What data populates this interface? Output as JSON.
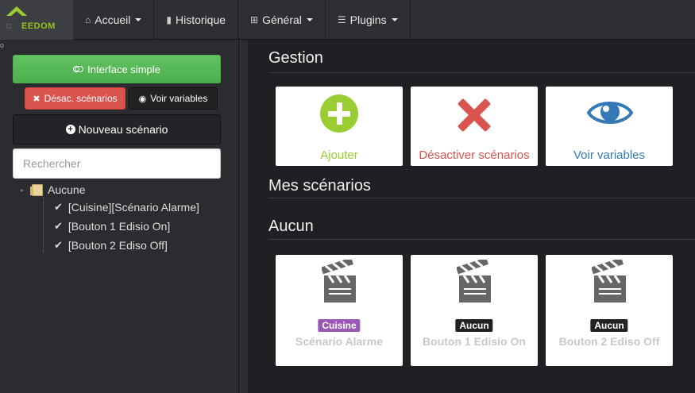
{
  "nav": {
    "brand": "EEDOM",
    "items": [
      {
        "icon": "home-icon",
        "label": "Accueil",
        "dropdown": true
      },
      {
        "icon": "bar-chart-icon",
        "label": "Historique",
        "dropdown": false
      },
      {
        "icon": "grid-icon",
        "label": "Général",
        "dropdown": true
      },
      {
        "icon": "list-icon",
        "label": "Plugins",
        "dropdown": true
      }
    ]
  },
  "sidebar": {
    "corner_mark": "o",
    "interface_button": "Interface simple",
    "disable_button": "Désac. scénarios",
    "variables_button": "Voir variables",
    "new_button": "Nouveau scénario",
    "search_placeholder": "Rechercher",
    "tree": {
      "root_label": "Aucune",
      "leaves": [
        "[Cuisine][Scénario Alarme]",
        "[Bouton 1 Edisio On]",
        "[Bouton 2 Ediso Off]"
      ]
    }
  },
  "main": {
    "gestion_title": "Gestion",
    "gestion_cards": [
      {
        "label": "Ajouter",
        "color": "#9acd32",
        "icon": "plus-circle-icon"
      },
      {
        "label": "Désactiver scénarios",
        "color": "#d9534f",
        "icon": "x-icon"
      },
      {
        "label": "Voir variables",
        "color": "#3479b7",
        "icon": "eye-icon"
      }
    ],
    "mes_scenarios_title": "Mes scénarios",
    "group_title": "Aucun",
    "scenario_cards": [
      {
        "badge": "Cuisine",
        "badge_color": "#9b59b6",
        "name": "Scénario Alarme"
      },
      {
        "badge": "Aucun",
        "badge_color": "#222222",
        "name": "Bouton 1 Edisio On"
      },
      {
        "badge": "Aucun",
        "badge_color": "#222222",
        "name": "Bouton 2 Ediso Off"
      }
    ]
  }
}
